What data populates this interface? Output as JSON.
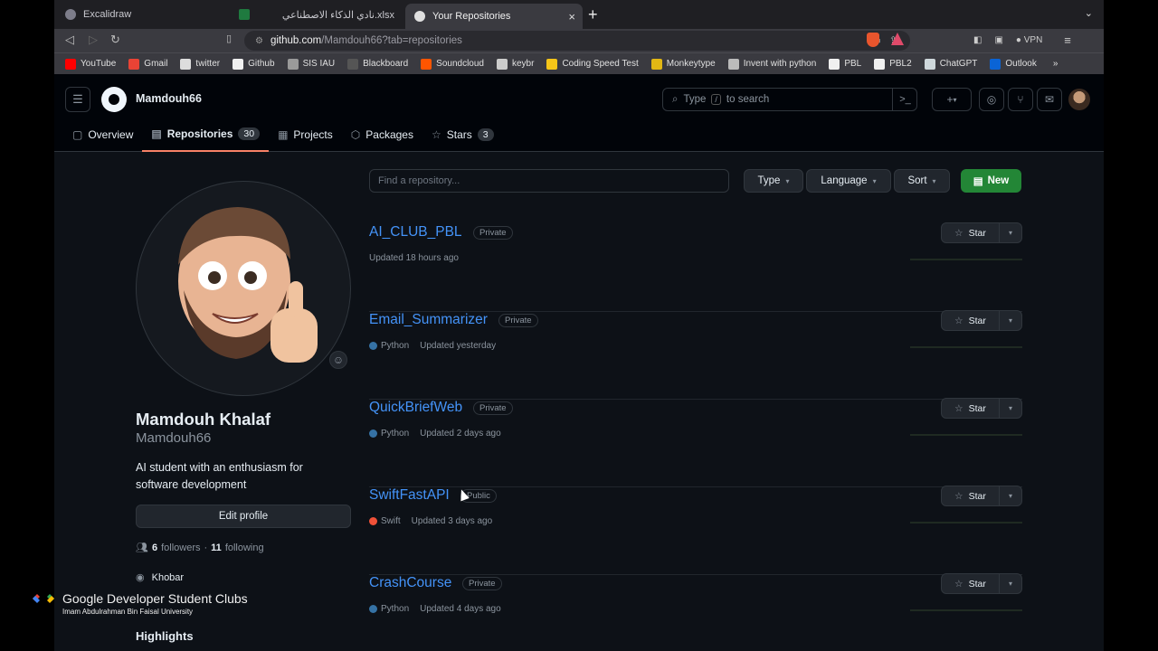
{
  "browser": {
    "tabs": [
      {
        "label": "Excalidraw",
        "color": "#7d7d8a"
      },
      {
        "label": "نادي الذكاء الاصطناعي.xlsx",
        "color": "#1f7a3f"
      },
      {
        "label": "Your Repositories",
        "color": "#e0e0e0",
        "close": "×"
      }
    ],
    "new_tab": "+",
    "tab_menu": "⌄",
    "url_host": "github.com",
    "url_path": "/Mamdouh66?tab=repositories",
    "vpn_label": "VPN",
    "bookmarks": [
      {
        "label": "YouTube",
        "color": "#ff0000"
      },
      {
        "label": "Gmail",
        "color": "#ea4335"
      },
      {
        "label": "twitter",
        "color": "#dddddd"
      },
      {
        "label": "Github",
        "color": "#f0f0f0"
      },
      {
        "label": "SIS IAU",
        "color": "#9a9a9a"
      },
      {
        "label": "Blackboard",
        "color": "#555555"
      },
      {
        "label": "Soundcloud",
        "color": "#ff5500"
      },
      {
        "label": "keybr",
        "color": "#cccccc"
      },
      {
        "label": "Coding Speed Test",
        "color": "#f5c518"
      },
      {
        "label": "Monkeytype",
        "color": "#e2b714"
      },
      {
        "label": "Invent with python",
        "color": "#bbbbbb"
      },
      {
        "label": "PBL",
        "color": "#f0f0f0"
      },
      {
        "label": "PBL2",
        "color": "#f0f0f0"
      },
      {
        "label": "ChatGPT",
        "color": "#cfd8dc"
      },
      {
        "label": "Outlook",
        "color": "#0a64d6"
      }
    ],
    "bookmarks_more": "»"
  },
  "github": {
    "username": "Mamdouh66",
    "search_placeholder_a": "Type",
    "search_key": "/",
    "search_placeholder_b": "to search",
    "tabs": [
      {
        "label": "Overview",
        "icon": "book-icon"
      },
      {
        "label": "Repositories",
        "icon": "repo-icon",
        "count": "30"
      },
      {
        "label": "Projects",
        "icon": "table-icon"
      },
      {
        "label": "Packages",
        "icon": "package-icon"
      },
      {
        "label": "Stars",
        "icon": "star-icon",
        "count": "3"
      }
    ]
  },
  "profile": {
    "name": "Mamdouh Khalaf",
    "login": "Mamdouh66",
    "bio": "AI student with an enthusiasm for software development",
    "edit_label": "Edit profile",
    "followers": "6",
    "followers_label": "followers",
    "sep": "·",
    "following": "11",
    "following_label": "following",
    "location": "Khobar",
    "highlights": "Highlights"
  },
  "repos_toolbar": {
    "filter_placeholder": "Find a repository...",
    "type": "Type",
    "language": "Language",
    "sort": "Sort",
    "new": "New"
  },
  "repos": [
    {
      "name": "AI_CLUB_PBL",
      "visibility": "Private",
      "language": "",
      "lang_color": "",
      "updated": "Updated 18 hours ago",
      "star": "Star"
    },
    {
      "name": "Email_Summarizer",
      "visibility": "Private",
      "language": "Python",
      "lang_color": "#3572A5",
      "updated": "Updated yesterday",
      "star": "Star"
    },
    {
      "name": "QuickBriefWeb",
      "visibility": "Private",
      "language": "Python",
      "lang_color": "#3572A5",
      "updated": "Updated 2 days ago",
      "star": "Star"
    },
    {
      "name": "SwiftFastAPI",
      "visibility": "Public",
      "language": "Swift",
      "lang_color": "#F05138",
      "updated": "Updated 3 days ago",
      "star": "Star"
    },
    {
      "name": "CrashCourse",
      "visibility": "Private",
      "language": "Python",
      "lang_color": "#3572A5",
      "updated": "Updated 4 days ago",
      "star": "Star"
    }
  ],
  "watermark": {
    "title": "Google Developer Student Clubs",
    "subtitle": "Imam Abdulrahman Bin Faisal University"
  }
}
